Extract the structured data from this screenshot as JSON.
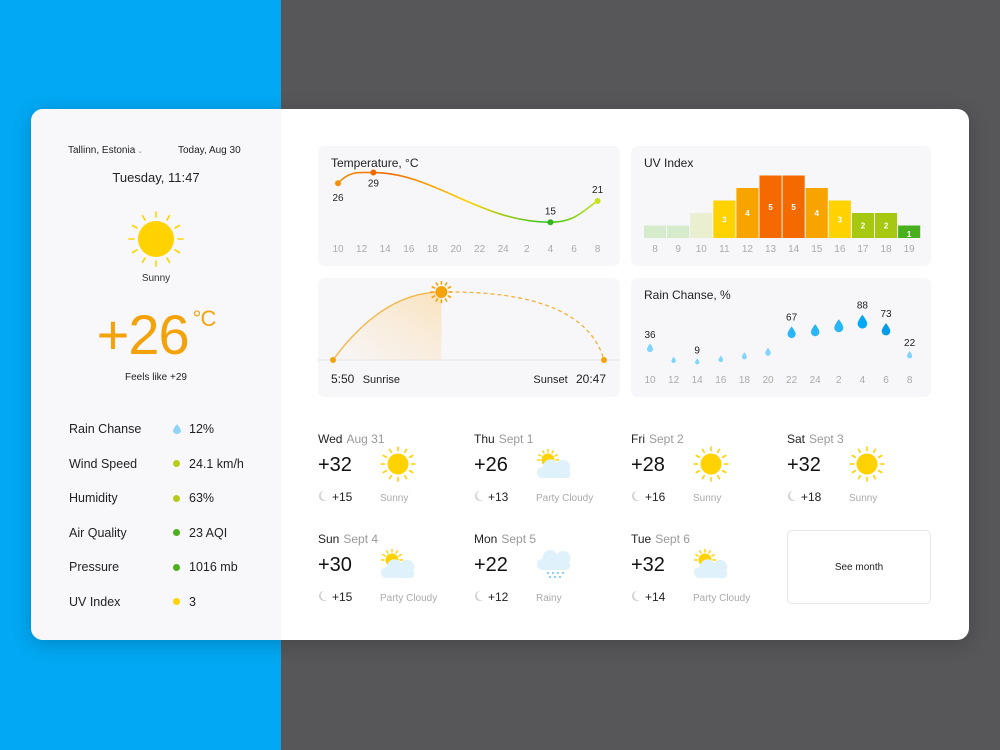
{
  "colors": {
    "accent_orange": "#f4a20a",
    "background_blue": "#02a8f4",
    "background_gray": "#57575a",
    "sun_yellow": "#ffd200",
    "rain_blue": "#4fc3f7"
  },
  "sidebar": {
    "location": "Tallinn, Estonia",
    "location_chevron": "⌄",
    "today_label": "Today, Aug 30",
    "datetime": "Tuesday, 11:47",
    "condition": "Sunny",
    "condition_icon": "sun-icon",
    "temperature": "+26",
    "unit": "°C",
    "feels_like": "Feels like +29",
    "stats": [
      {
        "label": "Rain Chanse",
        "value": "12%",
        "indicator": "raindrop",
        "color": "#8fd3f5"
      },
      {
        "label": "Wind Speed",
        "value": "24.1 km/h",
        "indicator": "dot",
        "color": "#b5cc18"
      },
      {
        "label": "Humidity",
        "value": "63%",
        "indicator": "dot",
        "color": "#b5cc18"
      },
      {
        "label": "Air Quality",
        "value": "23 AQI",
        "indicator": "dot",
        "color": "#4caf1c"
      },
      {
        "label": "Pressure",
        "value": "1016 mb",
        "indicator": "dot",
        "color": "#4caf1c"
      },
      {
        "label": "UV Index",
        "value": "3",
        "indicator": "dot",
        "color": "#ffd200"
      }
    ]
  },
  "chart_data": [
    {
      "type": "line",
      "title": "Temperature, °C",
      "x": [
        "10",
        "12",
        "14",
        "16",
        "18",
        "20",
        "22",
        "24",
        "2",
        "4",
        "6",
        "8"
      ],
      "labeled_points": [
        {
          "x_index": 0,
          "value": 26
        },
        {
          "x_index": 1.5,
          "value": 29
        },
        {
          "x_index": 9,
          "value": 15
        },
        {
          "x_index": 11,
          "value": 21
        }
      ],
      "gradient": [
        "#f4900a",
        "#f06a00",
        "#ffd200",
        "#35c21c",
        "#c9e31a"
      ]
    },
    {
      "type": "bar",
      "title": "UV Index",
      "categories": [
        "8",
        "9",
        "10",
        "11",
        "12",
        "13",
        "14",
        "15",
        "16",
        "17",
        "18",
        "19"
      ],
      "values": [
        0,
        0,
        1,
        3,
        4,
        5,
        5,
        4,
        3,
        2,
        2,
        1
      ],
      "labels": [
        "",
        "",
        "",
        "3",
        "4",
        "5",
        "5",
        "4",
        "3",
        "2",
        "2",
        "1"
      ],
      "display_levels": [
        1,
        1,
        2,
        3,
        4,
        5,
        5,
        4,
        3,
        2,
        2,
        1
      ],
      "bar_colors": [
        "#d6ebcc",
        "#d6ebcc",
        "#e9efcf",
        "#ffd200",
        "#f8a400",
        "#f46a00",
        "#f46a00",
        "#f8a400",
        "#ffd200",
        "#a6c810",
        "#a6c810",
        "#47b01c"
      ]
    },
    {
      "type": "area",
      "title": "Sun",
      "sunrise_time": "5:50",
      "sunrise_label": "Sunrise",
      "sunset_time": "20:47",
      "sunset_label": "Sunset",
      "day_progress": 0.4
    },
    {
      "type": "scatter",
      "title": "Rain Chanse, %",
      "x": [
        "10",
        "12",
        "14",
        "16",
        "18",
        "20",
        "22",
        "24",
        "2",
        "4",
        "6",
        "8"
      ],
      "values": [
        36,
        12,
        9,
        14,
        20,
        28,
        67,
        71,
        80,
        88,
        73,
        22
      ],
      "labels": [
        "36",
        "",
        "9",
        "",
        "",
        "",
        "67",
        "",
        "",
        "88",
        "73",
        "22"
      ]
    }
  ],
  "forecast": [
    {
      "day": "Wed",
      "date": "Aug 31",
      "high": "+32",
      "low": "+15",
      "condition": "Sunny",
      "icon": "sunny"
    },
    {
      "day": "Thu",
      "date": "Sept 1",
      "high": "+26",
      "low": "+13",
      "condition": "Party Cloudy",
      "icon": "partly-cloudy"
    },
    {
      "day": "Fri",
      "date": "Sept 2",
      "high": "+28",
      "low": "+16",
      "condition": "Sunny",
      "icon": "sunny"
    },
    {
      "day": "Sat",
      "date": "Sept 3",
      "high": "+32",
      "low": "+18",
      "condition": "Sunny",
      "icon": "sunny"
    },
    {
      "day": "Sun",
      "date": "Sept 4",
      "high": "+30",
      "low": "+15",
      "condition": "Party Cloudy",
      "icon": "partly-cloudy"
    },
    {
      "day": "Mon",
      "date": "Sept 5",
      "high": "+22",
      "low": "+12",
      "condition": "Rainy",
      "icon": "rainy"
    },
    {
      "day": "Tue",
      "date": "Sept 6",
      "high": "+32",
      "low": "+14",
      "condition": "Party Cloudy",
      "icon": "partly-cloudy"
    }
  ],
  "see_month_label": "See month"
}
